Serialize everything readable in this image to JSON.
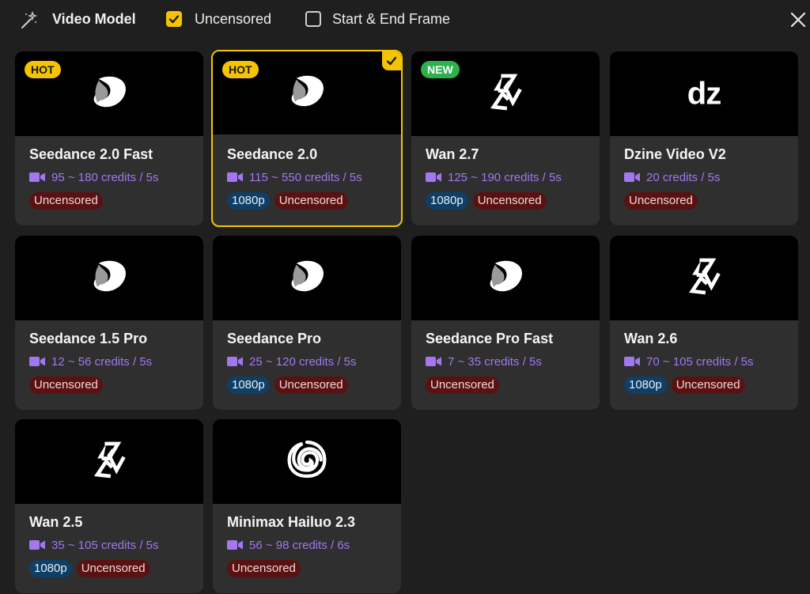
{
  "header": {
    "title": "Video Model",
    "uncensored_label": "Uncensored",
    "uncensored_checked": true,
    "start_end_label": "Start & End Frame",
    "start_end_checked": false
  },
  "colors": {
    "accent": "#f5c400",
    "credits": "#a277f0",
    "res_tag": "#0f3f66",
    "uncensored_tag": "#5a1111",
    "new_badge": "#2bb24c"
  },
  "models": [
    {
      "name": "Seedance 2.0 Fast",
      "credits": "95 ~ 180 credits / 5s",
      "badge": "HOT",
      "logo": "seedance-logo-icon",
      "tags": [
        "Uncensored"
      ],
      "selected": false
    },
    {
      "name": "Seedance 2.0",
      "credits": "115 ~ 550 credits / 5s",
      "badge": "HOT",
      "logo": "seedance-logo-icon",
      "tags": [
        "1080p",
        "Uncensored"
      ],
      "selected": true
    },
    {
      "name": "Wan 2.7",
      "credits": "125 ~ 190 credits / 5s",
      "badge": "NEW",
      "logo": "wan-logo-icon",
      "tags": [
        "1080p",
        "Uncensored"
      ],
      "selected": false
    },
    {
      "name": "Dzine Video V2",
      "credits": "20 credits / 5s",
      "badge": "",
      "logo": "dzine-logo-icon",
      "logo_text": "dz",
      "tags": [
        "Uncensored"
      ],
      "selected": false
    },
    {
      "name": "Seedance 1.5 Pro",
      "credits": "12 ~ 56 credits / 5s",
      "badge": "",
      "logo": "seedance-logo-icon",
      "tags": [
        "Uncensored"
      ],
      "selected": false
    },
    {
      "name": "Seedance Pro",
      "credits": "25 ~ 120 credits / 5s",
      "badge": "",
      "logo": "seedance-logo-icon",
      "tags": [
        "1080p",
        "Uncensored"
      ],
      "selected": false
    },
    {
      "name": "Seedance Pro Fast",
      "credits": "7 ~ 35 credits / 5s",
      "badge": "",
      "logo": "seedance-logo-icon",
      "tags": [
        "Uncensored"
      ],
      "selected": false
    },
    {
      "name": "Wan 2.6",
      "credits": "70 ~ 105 credits / 5s",
      "badge": "",
      "logo": "wan-logo-icon",
      "tags": [
        "1080p",
        "Uncensored"
      ],
      "selected": false
    },
    {
      "name": "Wan 2.5",
      "credits": "35 ~ 105 credits / 5s",
      "badge": "",
      "logo": "wan-logo-icon",
      "tags": [
        "1080p",
        "Uncensored"
      ],
      "selected": false
    },
    {
      "name": "Minimax Hailuo 2.3",
      "credits": "56 ~ 98 credits / 6s",
      "badge": "",
      "logo": "hailuo-logo-icon",
      "tags": [
        "Uncensored"
      ],
      "selected": false
    }
  ]
}
